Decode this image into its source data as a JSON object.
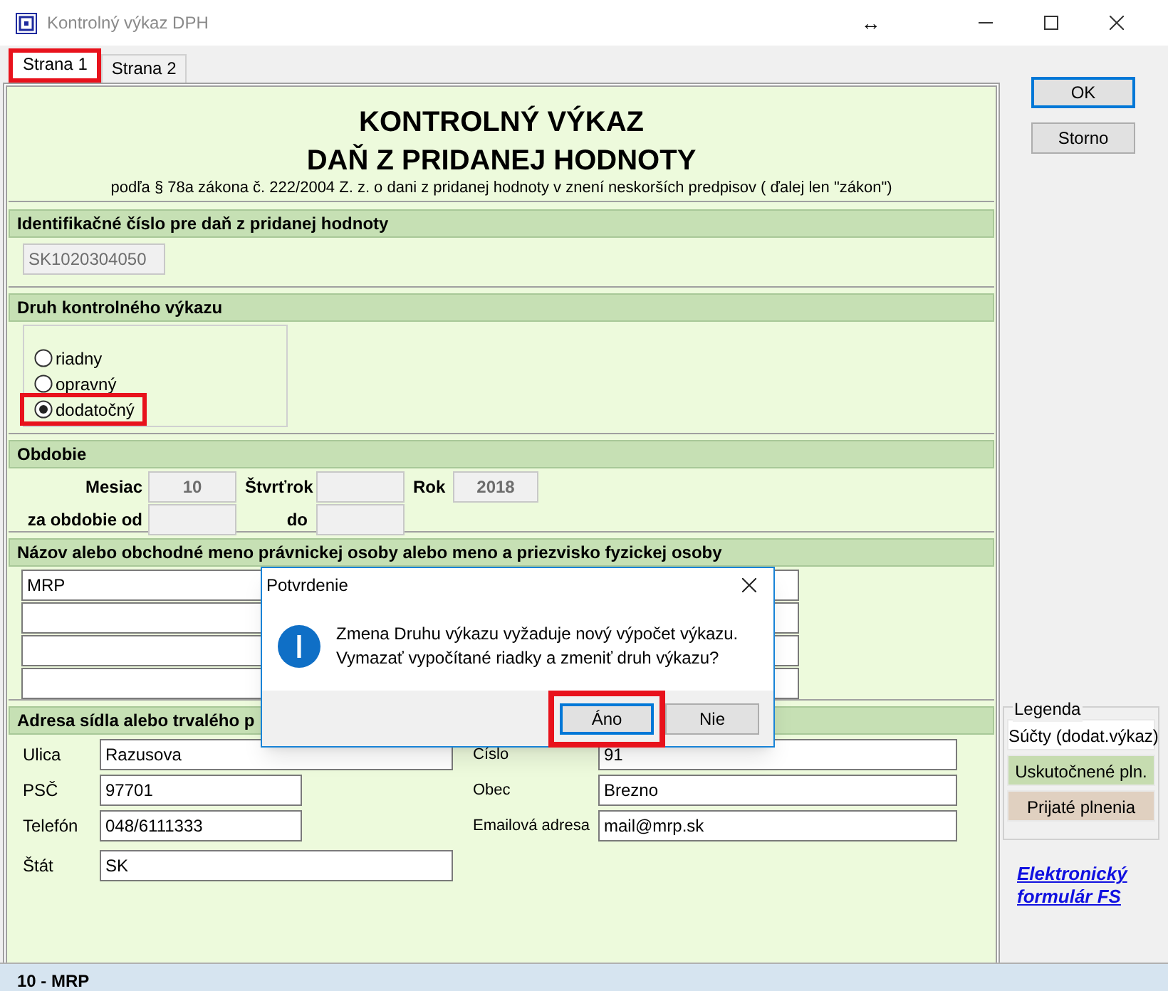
{
  "window": {
    "title": "Kontrolný výkaz DPH",
    "resize_glyph": "↔"
  },
  "tabs": [
    {
      "label": "Strana 1",
      "selected": true,
      "highlighted": true
    },
    {
      "label": "Strana 2",
      "selected": false,
      "highlighted": false
    }
  ],
  "form": {
    "title_1": "KONTROLNÝ VÝKAZ",
    "title_2": "DAŇ Z PRIDANEJ HODNOTY",
    "subtitle": "podľa § 78a zákona č. 222/2004 Z. z. o dani z pridanej hodnoty v znení neskorších predpisov ( ďalej len \"zákon\")",
    "id_section": {
      "heading": "Identifikačné číslo pre daň z pridanej hodnoty",
      "value": "SK1020304050"
    },
    "type_section": {
      "heading": "Druh kontrolného výkazu",
      "options": [
        {
          "label": "riadny",
          "selected": false,
          "highlighted": false
        },
        {
          "label": "opravný",
          "selected": false,
          "highlighted": false
        },
        {
          "label": "dodatočný",
          "selected": true,
          "highlighted": true
        }
      ]
    },
    "period_section": {
      "heading": "Obdobie",
      "month_label": "Mesiac",
      "month": "10",
      "quarter_label": "Štvrťrok",
      "year_label": "Rok",
      "year": "2018",
      "from_label": "za obdobie od",
      "to_label": "do"
    },
    "name_section": {
      "heading": "Názov alebo obchodné meno právnickej osoby alebo meno a priezvisko fyzickej osoby",
      "lines": [
        {
          "kind": "filled",
          "value": "MRP"
        },
        {
          "kind": "empty"
        },
        {
          "kind": "empty"
        },
        {
          "kind": "empty"
        }
      ]
    },
    "address_section": {
      "heading": "Adresa sídla alebo trvalého p",
      "left": [
        {
          "label": "Ulica",
          "value": "Razusova",
          "kind": "wide"
        },
        {
          "label": "PSČ",
          "value": "97701",
          "kind": "short"
        },
        {
          "label": "Telefón",
          "value": "048/6111333",
          "kind": "short"
        },
        {
          "label": "Štát",
          "value": "SK",
          "kind": "wide"
        }
      ],
      "right": [
        {
          "label": "Číslo",
          "value": "91"
        },
        {
          "label": "Obec",
          "value": "Brezno"
        },
        {
          "label": "Emailová adresa",
          "value": "mail@mrp.sk"
        }
      ]
    }
  },
  "buttons": [
    {
      "label": "OK",
      "default": true
    },
    {
      "label": "Storno",
      "default": false
    }
  ],
  "legend": {
    "title": "Legenda",
    "items": [
      {
        "label": "Súčty (dodat.výkaz)",
        "color": "#ffffff"
      },
      {
        "label": "Uskutočnené pln.",
        "color": "#c6dcb0"
      },
      {
        "label": "Prijaté plnenia",
        "color": "#e0d0c0"
      }
    ]
  },
  "link": {
    "line_1": "Elektronický",
    "line_2": "formulár FS"
  },
  "dialog": {
    "title": "Potvrdenie",
    "message_1": "Zmena Druhu výkazu vyžaduje nový výpočet výkazu.",
    "message_2": "Vymazať vypočítané riadky a zmeniť druh výkazu?",
    "buttons": [
      {
        "label": "Áno",
        "default": true,
        "highlighted": true
      },
      {
        "label": "Nie",
        "default": false,
        "highlighted": false
      }
    ]
  },
  "status_bar": {
    "text": "10 - MRP"
  }
}
